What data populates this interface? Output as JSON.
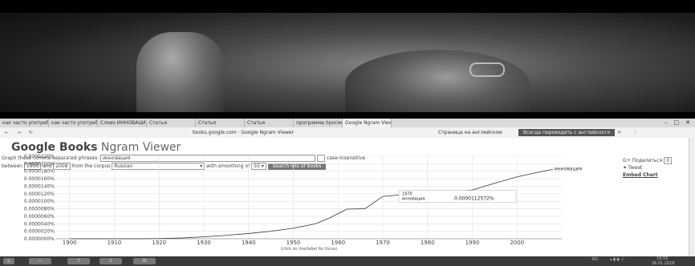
{
  "browser": {
    "tabs": [
      {
        "label": "как часто употреблялось",
        "active": false
      },
      {
        "label": "как часто употреблялось",
        "active": false
      },
      {
        "label": "Слово ИННОВАЦИЯ",
        "active": false
      },
      {
        "label": "Статья",
        "active": false
      },
      {
        "label": "Статья",
        "active": false
      },
      {
        "label": "Статья",
        "active": false
      },
      {
        "label": "программа просмотра",
        "active": false
      },
      {
        "label": "Google Ngram Viewer",
        "active": true
      }
    ],
    "url": "books.google.com · Google Ngram Viewer",
    "translate_prompt": "Страница на английском",
    "translate_button": "Всегда переводить с английского"
  },
  "ngram": {
    "logo_brand": "Google Books",
    "logo_product": "Ngram Viewer",
    "phrases_label": "Graph these comma-separated phrases:",
    "phrases_value": "инновация",
    "case_label": "case-insensitive",
    "between_label": "between",
    "year_start": "1900",
    "and_label": "and",
    "year_end": "2008",
    "corpus_label": "from the corpus",
    "corpus_value": "Russian",
    "smoothing_label": "with smoothing of",
    "smoothing_value": "50",
    "search_button": "Search lots of books",
    "share_gplus": "Поделиться",
    "share_count": "0",
    "share_tweet": "Tweet",
    "embed_label": "Embed Chart"
  },
  "chart_data": {
    "type": "line",
    "title": "",
    "xlabel": "(click on line/label for focus)",
    "ylabel": "",
    "xlim": [
      1897,
      2010
    ],
    "ylim": [
      0,
      2.2e-07
    ],
    "x_ticks": [
      "1900",
      "1910",
      "1920",
      "1930",
      "1940",
      "1950",
      "1960",
      "1970",
      "1980",
      "1990",
      "2000"
    ],
    "x_tick_values": [
      1900,
      1910,
      1920,
      1930,
      1940,
      1950,
      1960,
      1970,
      1980,
      1990,
      2000
    ],
    "y_ticks": [
      "0.0000220%",
      "0.0000200%",
      "0.0000180%",
      "0.0000160%",
      "0.0000140%",
      "0.0000120%",
      "0.0000100%",
      "0.0000080%",
      "0.0000060%",
      "0.0000040%",
      "0.0000020%",
      "0.0000000%"
    ],
    "y_tick_values": [
      2.2e-07,
      2e-07,
      1.8e-07,
      1.6e-07,
      1.4e-07,
      1.2e-07,
      1e-07,
      8e-08,
      6e-08,
      4e-08,
      2e-08,
      0
    ],
    "grid": true,
    "series": [
      {
        "name": "инновация",
        "color": "#333333",
        "x": [
          1900,
          1910,
          1915,
          1920,
          1925,
          1930,
          1935,
          1940,
          1945,
          1950,
          1955,
          1958,
          1962,
          1966,
          1970,
          1975,
          1980,
          1985,
          1990,
          1995,
          2000,
          2005,
          2008
        ],
        "y": [
          0.0,
          0.0,
          0.0,
          6e-10,
          2e-09,
          5e-09,
          9e-09,
          1.4e-08,
          2e-08,
          2.8e-08,
          4e-08,
          5.5e-08,
          7.9e-08,
          8e-08,
          1.13e-07,
          1.18e-07,
          1.22e-07,
          1.26e-07,
          1.3e-07,
          1.48e-07,
          1.65e-07,
          1.78e-07,
          1.85e-07
        ]
      }
    ],
    "tooltip": {
      "year": "1970",
      "label": "инновация",
      "value": "0.0000112572%"
    }
  },
  "taskbar": {
    "tray_lang": "RU",
    "time": "18:55",
    "date": "26.01.2018"
  }
}
